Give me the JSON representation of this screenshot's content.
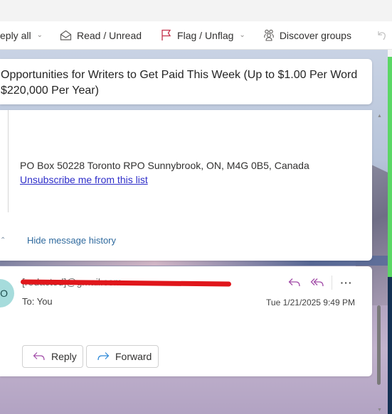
{
  "toolbar": {
    "reply_all": "eply all",
    "read_unread": "Read / Unread",
    "flag_unflag": "Flag / Unflag",
    "discover_groups": "Discover groups",
    "undo": "Un"
  },
  "subject": {
    "line1": "Opportunities for Writers to Get Paid This Week (Up to $1.00 Per Word",
    "line2": "$220,000 Per Year)"
  },
  "previous_message": {
    "address": "PO Box 50228 Toronto RPO Sunnybrook, ON, M4G 0B5, Canada",
    "unsubscribe_link": "Unsubscribe me from this list",
    "hide_history_label": "Hide message history"
  },
  "message": {
    "avatar_initial": "O",
    "sender_redacted": "[redacted]@gmail.com",
    "to_label": "To:  You",
    "timestamp": "Tue 1/21/2025 9:49 PM",
    "reply_label": "Reply",
    "forward_label": "Forward",
    "more_label": "···"
  },
  "colors": {
    "reply_icon": "#a24ca8",
    "forward_icon": "#2b88d8",
    "flag_icon": "#c4314b",
    "link": "#2e2ec9",
    "history_link": "#2f6a9e",
    "avatar_bg": "#a6dcdc",
    "redaction": "#e0161b"
  }
}
